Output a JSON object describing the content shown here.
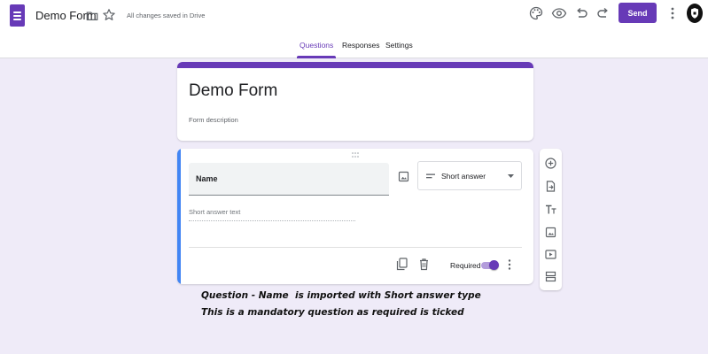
{
  "header": {
    "form_title": "Demo Form",
    "save_status": "All changes saved in Drive",
    "send_label": "Send",
    "icons": [
      "forms-logo-icon",
      "folder-icon",
      "star-icon",
      "palette-icon",
      "preview-eye-icon",
      "undo-icon",
      "redo-icon",
      "more-vert-icon",
      "avatar"
    ]
  },
  "tabs": [
    {
      "label": "Questions",
      "active": true
    },
    {
      "label": "Responses",
      "active": false
    },
    {
      "label": "Settings",
      "active": false
    }
  ],
  "title_card": {
    "title": "Demo Form",
    "description_placeholder": "Form description"
  },
  "question": {
    "title": "Name",
    "type": "Short answer",
    "answer_placeholder": "Short answer text",
    "required_label": "Required",
    "required": true
  },
  "side_toolbar": [
    "add-question-icon",
    "import-questions-icon",
    "add-title-icon",
    "add-image-icon",
    "add-video-icon",
    "add-section-icon"
  ],
  "annotation": {
    "line1": "Question - Name  is imported with Short answer type",
    "line2": "This is a mandatory question as required is ticked"
  },
  "colors": {
    "accent": "#673ab7",
    "background": "#efebf8",
    "focus_border": "#4285f4"
  }
}
